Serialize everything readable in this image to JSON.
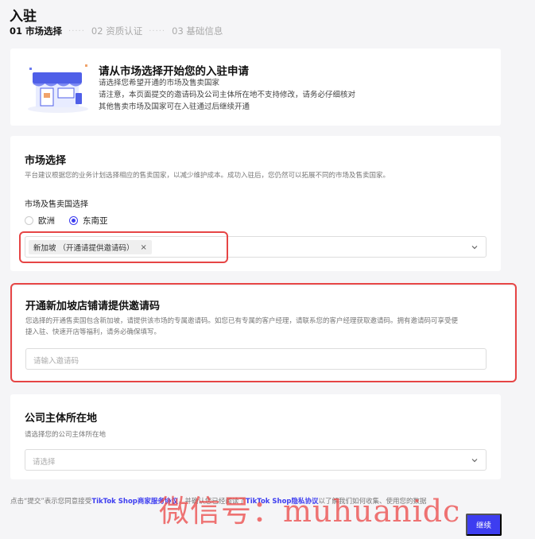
{
  "page": {
    "title": "入驻",
    "steps": [
      {
        "label": "01 市场选择",
        "active": true
      },
      {
        "label": "02 资质认证",
        "active": false
      },
      {
        "label": "03 基础信息",
        "active": false
      }
    ],
    "step_separator": "·····"
  },
  "intro": {
    "title": "请从市场选择开始您的入驻申请",
    "lines": [
      "请选择您希望开通的市场及售卖国家",
      "请注意，本页面提交的邀请码及公司主体所在地不支持修改，请务必仔细核对",
      "其他售卖市场及国家可在入驻通过后继续开通"
    ],
    "illustration": "storefront-illustration"
  },
  "market": {
    "title": "市场选择",
    "description": "平台建议根据您的业务计划选择相应的售卖国家，以减少维护成本。成功入驻后，您仍然可以拓展不同的市场及售卖国家。",
    "field_label": "市场及售卖国选择",
    "radios": [
      {
        "label": "欧洲",
        "checked": false
      },
      {
        "label": "东南亚",
        "checked": true
      }
    ],
    "selected_tag": "新加坡 （开通请提供邀请码）",
    "tag_close": "×"
  },
  "invite": {
    "title": "开通新加坡店铺请提供邀请码",
    "description_lines": [
      "您选择的开通售卖国包含新加坡，请提供该市场的专属邀请码。如您已有专属的客户经理，请联系您的客户经理获取邀请码。拥有邀请码可享受便",
      "捷入驻、快速开店等福利，请务必确保填写。"
    ],
    "placeholder": "请输入邀请码"
  },
  "company": {
    "title": "公司主体所在地",
    "description": "请选择您的公司主体所在地",
    "placeholder": "请选择"
  },
  "agreement": {
    "prefix": "点击“提交”表示您同意接受",
    "link1": "TikTok Shop商家服务协议",
    "middle": "，并确认您已经阅读了",
    "link2": "TikTok Shop隐私协议",
    "suffix": "以了解我们如何收集、使用您的数据"
  },
  "continue_label": "继续",
  "watermark": "微信号：muhuanidc",
  "colors": {
    "accent": "#3d3df0",
    "highlight": "#e64545"
  }
}
